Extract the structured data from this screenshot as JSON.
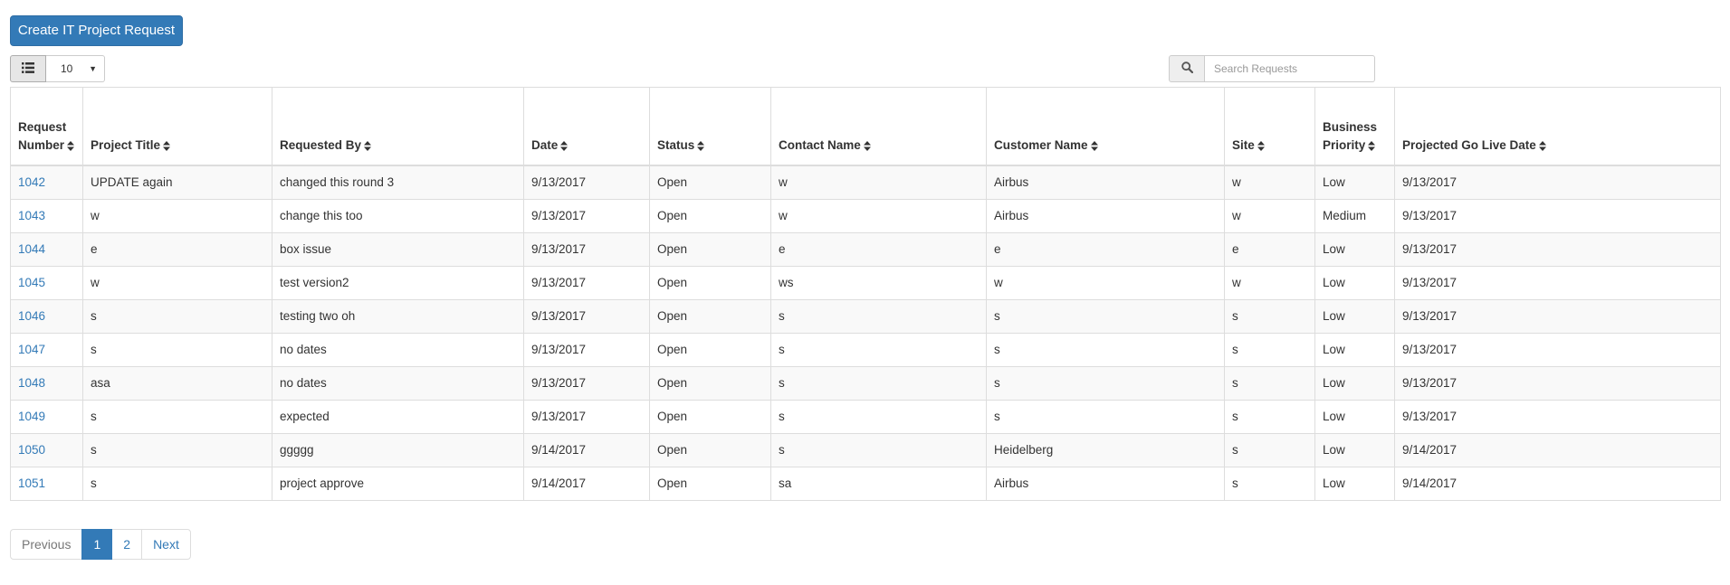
{
  "toolbar": {
    "create_button_label": "Create IT Project Request",
    "view_toggle_icon": "list-icon",
    "page_size": "10",
    "search_icon": "search-icon",
    "search_placeholder": "Search Requests"
  },
  "table": {
    "columns": [
      "Request Number",
      "Project Title",
      "Requested By",
      "Date",
      "Status",
      "Contact Name",
      "Customer Name",
      "Site",
      "Business Priority",
      "Projected Go Live Date"
    ],
    "rows": [
      [
        "1042",
        "UPDATE again",
        "changed this round 3",
        "9/13/2017",
        "Open",
        "w",
        "Airbus",
        "w",
        "Low",
        "9/13/2017"
      ],
      [
        "1043",
        "w",
        "change this too",
        "9/13/2017",
        "Open",
        "w",
        "Airbus",
        "w",
        "Medium",
        "9/13/2017"
      ],
      [
        "1044",
        "e",
        "box issue",
        "9/13/2017",
        "Open",
        "e",
        "e",
        "e",
        "Low",
        "9/13/2017"
      ],
      [
        "1045",
        "w",
        "test version2",
        "9/13/2017",
        "Open",
        "ws",
        "w",
        "w",
        "Low",
        "9/13/2017"
      ],
      [
        "1046",
        "s",
        "testing two oh",
        "9/13/2017",
        "Open",
        "s",
        "s",
        "s",
        "Low",
        "9/13/2017"
      ],
      [
        "1047",
        "s",
        "no dates",
        "9/13/2017",
        "Open",
        "s",
        "s",
        "s",
        "Low",
        "9/13/2017"
      ],
      [
        "1048",
        "asa",
        "no dates",
        "9/13/2017",
        "Open",
        "s",
        "s",
        "s",
        "Low",
        "9/13/2017"
      ],
      [
        "1049",
        "s",
        "expected",
        "9/13/2017",
        "Open",
        "s",
        "s",
        "s",
        "Low",
        "9/13/2017"
      ],
      [
        "1050",
        "s",
        "ggggg",
        "9/14/2017",
        "Open",
        "s",
        "Heidelberg",
        "s",
        "Low",
        "9/14/2017"
      ],
      [
        "1051",
        "s",
        "project approve",
        "9/14/2017",
        "Open",
        "sa",
        "Airbus",
        "s",
        "Low",
        "9/14/2017"
      ]
    ]
  },
  "pagination": {
    "previous_label": "Previous",
    "pages": [
      "1",
      "2"
    ],
    "current_page": "1",
    "next_label": "Next"
  },
  "colors": {
    "primary": "#337ab7",
    "border": "#dddddd",
    "stripe": "#f9f9f9"
  }
}
